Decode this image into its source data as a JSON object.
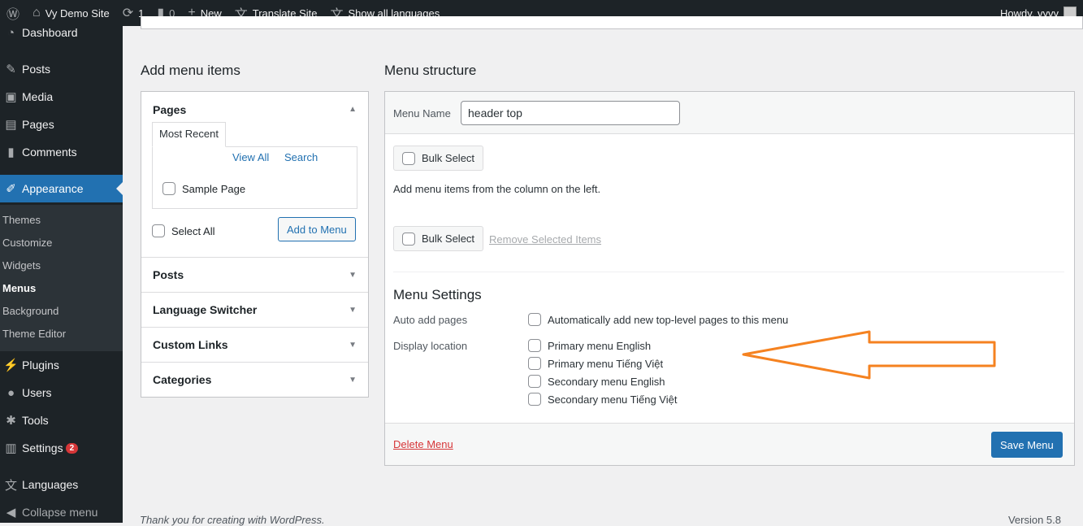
{
  "adminbar": {
    "site": "Vy Demo Site",
    "updates": "1",
    "comments": "0",
    "new": "New",
    "translate": "Translate Site",
    "languages": "Show all languages",
    "howdy": "Howdy, vyvy"
  },
  "sidebar": {
    "items": [
      "Dashboard",
      "Posts",
      "Media",
      "Pages",
      "Comments",
      "Appearance",
      "Plugins",
      "Users",
      "Tools",
      "Settings",
      "Languages",
      "Collapse menu"
    ],
    "settings_badge": "2",
    "submenu": [
      "Themes",
      "Customize",
      "Widgets",
      "Menus",
      "Background",
      "Theme Editor"
    ]
  },
  "left": {
    "title": "Add menu items",
    "pages": "Pages",
    "tabs": [
      "Most Recent",
      "View All",
      "Search"
    ],
    "sample": "Sample Page",
    "select_all": "Select All",
    "add": "Add to Menu",
    "sections": [
      "Posts",
      "Language Switcher",
      "Custom Links",
      "Categories"
    ]
  },
  "right": {
    "title": "Menu structure",
    "menu_name_label": "Menu Name",
    "menu_name": "header top",
    "bulk": "Bulk Select",
    "hint": "Add menu items from the column on the left.",
    "remove": "Remove Selected Items",
    "settings_title": "Menu Settings",
    "auto_label": "Auto add pages",
    "auto_opt": "Automatically add new top-level pages to this menu",
    "loc_label": "Display location",
    "locations": [
      "Primary menu English",
      "Primary menu Tiếng Việt",
      "Secondary menu English",
      "Secondary menu Tiếng Việt"
    ],
    "delete": "Delete Menu",
    "save": "Save Menu"
  },
  "footer": {
    "thanks": "Thank you for creating with WordPress.",
    "version": "Version 5.8"
  },
  "colors": {
    "accent": "#2271b1",
    "annotation_arrow": "#f58220",
    "badge": "#d63638"
  }
}
